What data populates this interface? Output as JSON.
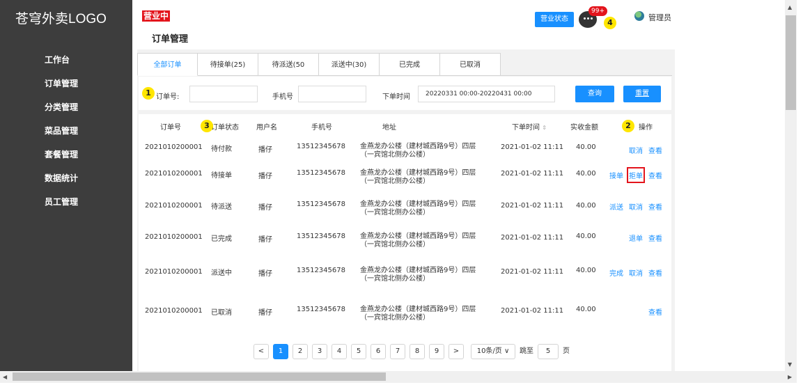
{
  "logo": "苍穹外卖LOGO",
  "status_tag": "营业中",
  "page_title": "订单管理",
  "header": {
    "status_button": "营业状态",
    "badge": "99+",
    "admin": "管理员"
  },
  "sidebar": {
    "items": [
      "工作台",
      "订单管理",
      "分类管理",
      "菜品管理",
      "套餐管理",
      "数据统计",
      "员工管理"
    ]
  },
  "tabs": [
    "全部订单",
    "待接单(25)",
    "待派送(50",
    "派送中(30)",
    "已完成",
    "已取消"
  ],
  "filter": {
    "order_label": "订单号:",
    "phone_label": "手机号",
    "time_label": "下单时间",
    "time_value": "20220331 00:00-20220431 00:00",
    "query_button": "查询",
    "reset_button": "重置"
  },
  "callouts": [
    "1",
    "2",
    "3",
    "4"
  ],
  "table": {
    "headers": [
      "订单号",
      "订单状态",
      "用户名",
      "手机号",
      "地址",
      "下单时间",
      "实收金额",
      "操作"
    ],
    "sort_icon": "sort-icon",
    "rows": [
      {
        "id": "2021010200001",
        "status": "待付款",
        "user": "播仔",
        "phone": "13512345678",
        "addr1": "金燕龙办公楼（建材城西路9号）四层",
        "addr2": "（一宾馆北侧办公楼）",
        "time": "2021-01-02 11:11",
        "amount": "40.00",
        "ops": [
          "取消",
          "查看"
        ]
      },
      {
        "id": "2021010200001",
        "status": "待接单",
        "user": "播仔",
        "phone": "13512345678",
        "addr1": "金燕龙办公楼（建材城西路9号）四层",
        "addr2": "（一宾馆北侧办公楼）",
        "time": "2021-01-02 11:11",
        "amount": "40.00",
        "ops": [
          "接单",
          "拒单",
          "查看"
        ]
      },
      {
        "id": "2021010200001",
        "status": "待派送",
        "user": "播仔",
        "phone": "13512345678",
        "addr1": "金燕龙办公楼（建材城西路9号）四层",
        "addr2": "（一宾馆北侧办公楼）",
        "time": "2021-01-02 11:11",
        "amount": "40.00",
        "ops": [
          "派送",
          "取消",
          "查看"
        ]
      },
      {
        "id": "2021010200001",
        "status": "已完成",
        "user": "播仔",
        "phone": "13512345678",
        "addr1": "金燕龙办公楼（建材城西路9号）四层",
        "addr2": "（一宾馆北侧办公楼）",
        "time": "2021-01-02 11:11",
        "amount": "40.00",
        "ops": [
          "退单",
          "查看"
        ]
      },
      {
        "id": "2021010200001",
        "status": "派送中",
        "user": "播仔",
        "phone": "13512345678",
        "addr1": "金燕龙办公楼（建材城西路9号）四层",
        "addr2": "（一宾馆北侧办公楼）",
        "time": "2021-01-02 11:11",
        "amount": "40.00",
        "ops": [
          "完成",
          "取消",
          "查看"
        ]
      },
      {
        "id": "2021010200001",
        "status": "已取消",
        "user": "播仔",
        "phone": "13512345678",
        "addr1": "金燕龙办公楼（建材城西路9号）四层",
        "addr2": "（一宾馆北侧办公楼）",
        "time": "2021-01-02 11:11",
        "amount": "40.00",
        "ops": [
          "查看"
        ]
      }
    ]
  },
  "pager": {
    "prev": "<",
    "pages": [
      "1",
      "2",
      "3",
      "4",
      "5",
      "6",
      "7",
      "8",
      "9"
    ],
    "next": ">",
    "page_size": "10条/页 ∨",
    "jump_label": "跳至",
    "jump_value": "5",
    "page_unit": "页"
  }
}
